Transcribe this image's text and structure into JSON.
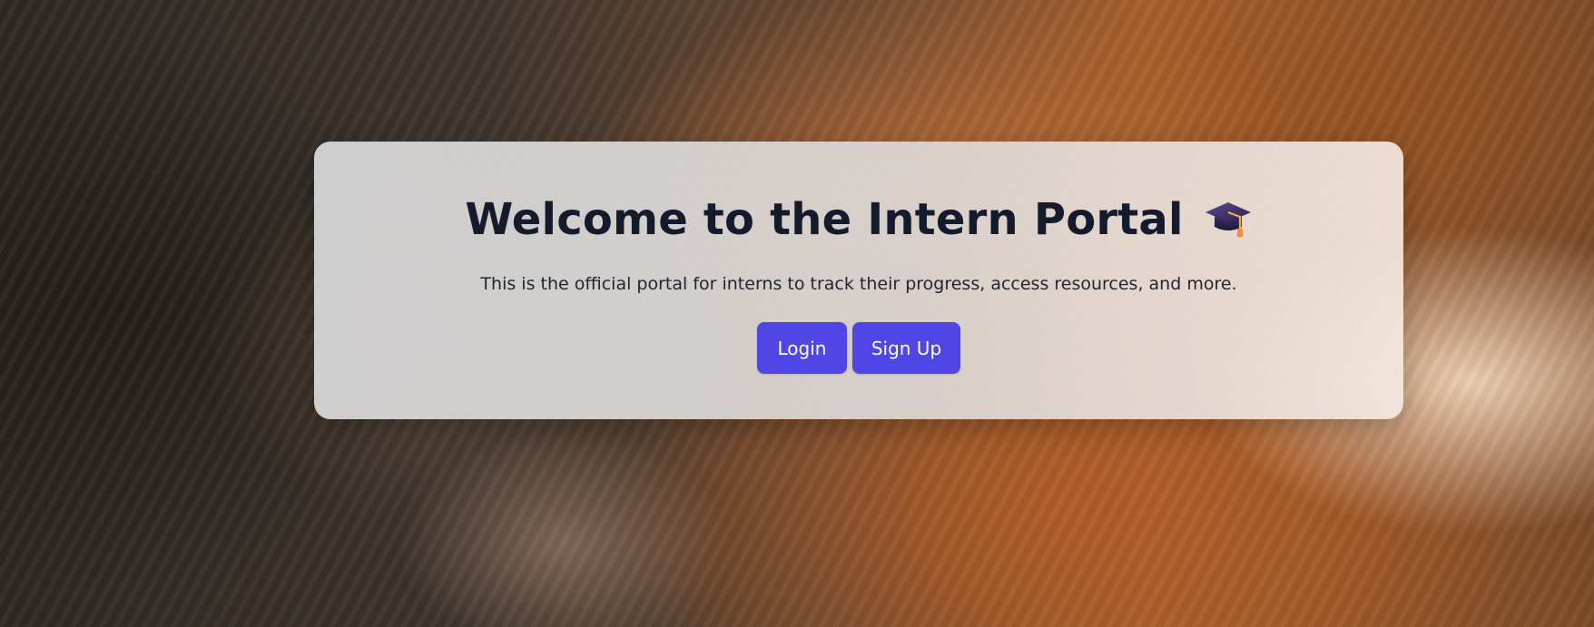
{
  "hero": {
    "title": "Welcome to the Intern Portal",
    "title_icon": "graduation-cap-icon",
    "subtitle": "This is the official portal for interns to track their progress, access resources, and more."
  },
  "actions": {
    "login_label": "Login",
    "signup_label": "Sign Up"
  },
  "colors": {
    "accent": "#4f46e5",
    "title_text": "#141b2c",
    "body_text": "#23262e"
  }
}
